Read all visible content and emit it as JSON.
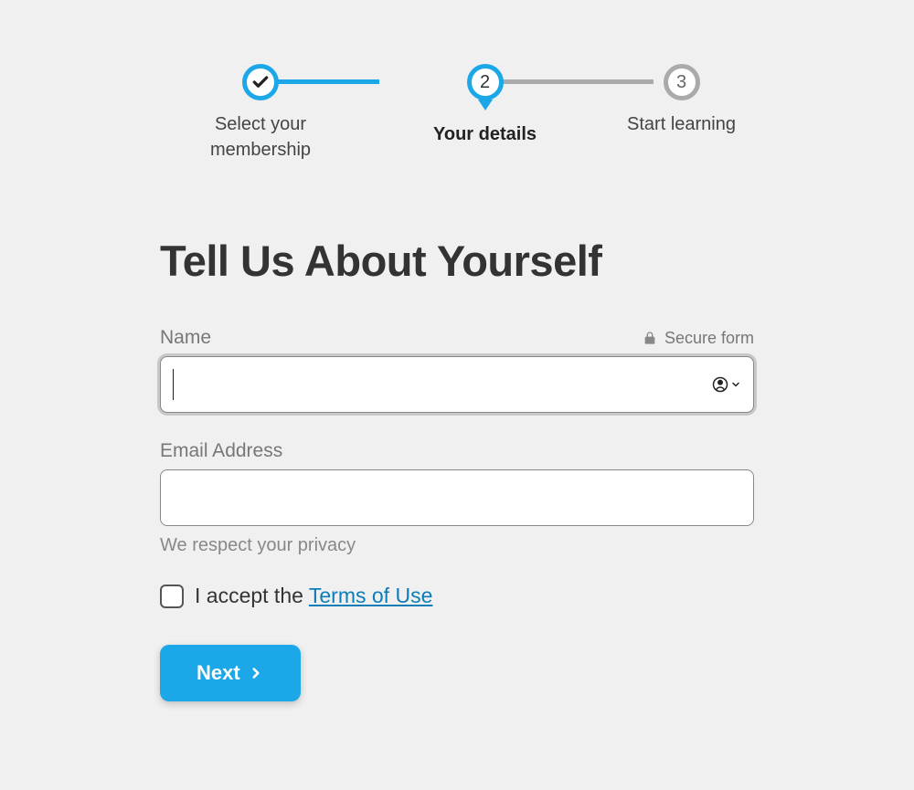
{
  "stepper": {
    "steps": [
      {
        "label": "Select your membership",
        "state": "completed"
      },
      {
        "label": "Your details",
        "number": "2",
        "state": "current"
      },
      {
        "label": "Start learning",
        "number": "3",
        "state": "upcoming"
      }
    ]
  },
  "page": {
    "title": "Tell Us About Yourself"
  },
  "form": {
    "name": {
      "label": "Name",
      "value": "",
      "secure_badge": "Secure form"
    },
    "email": {
      "label": "Email Address",
      "value": "",
      "help": "We respect your privacy"
    },
    "consent": {
      "prefix": "I accept the ",
      "link_text": "Terms of Use",
      "checked": false
    },
    "next_button": "Next"
  }
}
